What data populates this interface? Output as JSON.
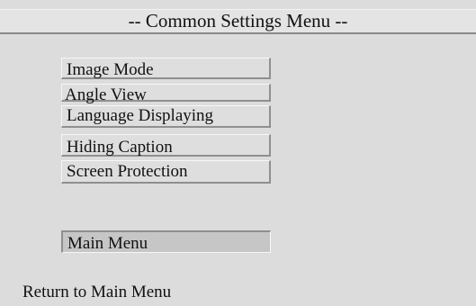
{
  "menu": {
    "title": "-- Common Settings Menu --",
    "items": [
      {
        "label": "Image Mode"
      },
      {
        "label": "Angle View"
      },
      {
        "label": "Language Displaying"
      },
      {
        "label": "Hiding Caption"
      },
      {
        "label": "Screen Protection"
      }
    ],
    "main_menu": {
      "label": "Main Menu",
      "selected": true
    }
  },
  "status": {
    "text": "Return to Main Menu"
  },
  "colors": {
    "background": "#dcdcdc",
    "selected_item": "#c6c6c6",
    "text": "#111111"
  }
}
